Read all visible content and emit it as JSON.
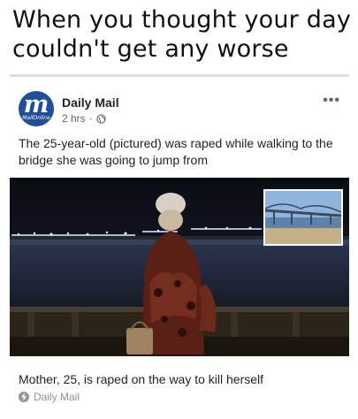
{
  "meme": {
    "caption": "When you thought your day\ncouldn't get any worse"
  },
  "post": {
    "page_name": "Daily Mail",
    "logo_letter": "m",
    "logo_subtext": "MailOnline",
    "time": "2 hrs",
    "separator": "·",
    "privacy_icon": "globe-icon",
    "more_icon": "ellipsis-icon",
    "text": "The 25-year-old (pictured) was raped while walking to the bridge she was going to jump from",
    "link": {
      "title": "Mother, 25, is raped on the way to kill herself",
      "source": "Daily Mail",
      "source_icon": "instant-article-bolt-icon"
    }
  },
  "colors": {
    "logo_blue": "#1f4f9a",
    "text_primary": "#1d2129",
    "text_secondary": "#606770",
    "divider": "#dddfe2"
  }
}
